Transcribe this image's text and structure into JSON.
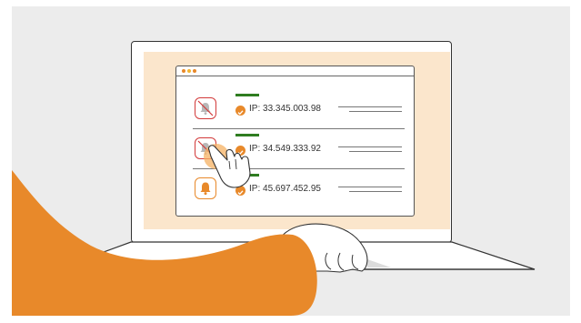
{
  "illustration": {
    "colors": {
      "background": "#ececec",
      "screen_bg": "#fbe6cc",
      "accent_orange": "#e8892a",
      "status_green": "#2f7d21",
      "muted_red": "#d23a3a",
      "text_dark": "#333333"
    },
    "window_dots": [
      "#e8892a",
      "#f2b431",
      "#e8892a"
    ],
    "rows": [
      {
        "ip_label": "IP: 33.345.003.98",
        "bell_state": "muted",
        "bell_icon": "bell-off-icon"
      },
      {
        "ip_label": "IP: 34.549.333.92",
        "bell_state": "muted",
        "bell_icon": "bell-off-icon"
      },
      {
        "ip_label": "IP: 45.697.452.95",
        "bell_state": "active",
        "bell_icon": "bell-icon"
      }
    ]
  }
}
